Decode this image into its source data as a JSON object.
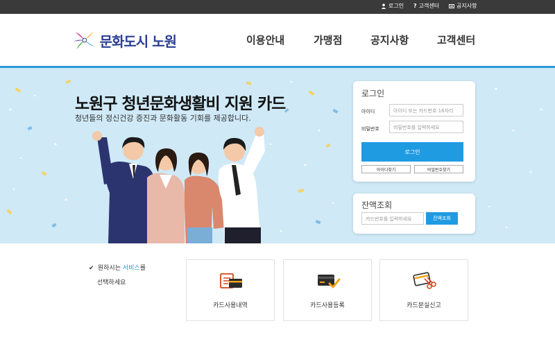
{
  "top_links": [
    {
      "label": "로그인",
      "icon": "person-icon"
    },
    {
      "label": "고객센터",
      "icon": "question-icon"
    },
    {
      "label": "공지사항",
      "icon": "notice-icon"
    }
  ],
  "logo": {
    "text": "문화도시 노원"
  },
  "nav": [
    {
      "label": "이용안내"
    },
    {
      "label": "가맹점"
    },
    {
      "label": "공지사항"
    },
    {
      "label": "고객센터"
    }
  ],
  "hero": {
    "title": "노원구 청년문화생활비 지원 카드",
    "subtitle": "청년들의 정신건강 증진과 문화활동 기회를 제공합니다."
  },
  "login": {
    "title": "로그인",
    "id_label": "아이디",
    "id_placeholder": "아이디 또는 카드번호 16자리",
    "pw_label": "비밀번호",
    "pw_placeholder": "비밀번호를 입력하세요",
    "login_button": "로그인",
    "find_id": "아이디찾기",
    "find_pw": "비밀번호찾기"
  },
  "balance": {
    "title": "잔액조회",
    "placeholder": "카드번호를 입력하세요",
    "button": "잔액조회"
  },
  "services": {
    "prompt_pre": "원하시는 ",
    "prompt_accent": "서비스",
    "prompt_post": "를",
    "prompt_line2": "선택하세요",
    "items": [
      {
        "label": "카드사용내역",
        "icon": "card-history-icon"
      },
      {
        "label": "카드사용등록",
        "icon": "card-register-icon"
      },
      {
        "label": "카드분실신고",
        "icon": "card-lost-icon"
      }
    ]
  },
  "colors": {
    "accent": "#1f9be2",
    "topbar": "#3a3a3a",
    "hero_bg": "#cfe9f7",
    "brand": "#2a3e93"
  }
}
